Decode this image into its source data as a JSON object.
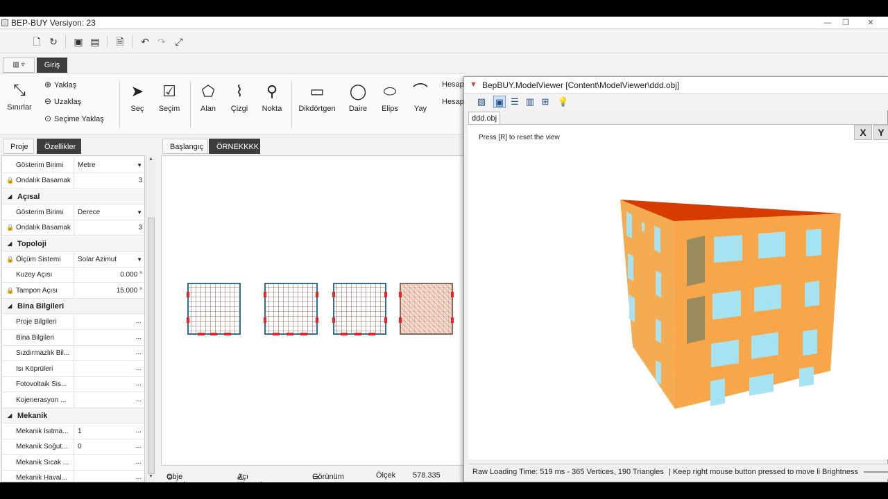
{
  "app": {
    "title": "BEP-BUY Versiyon: 23"
  },
  "ribbon": {
    "tab_giris": "Giriş",
    "sinirlar": "Sınırlar",
    "yaklas": "Yaklaş",
    "uzaklas": "Uzaklaş",
    "secime_yaklas": "Seçime Yaklaş",
    "sec": "Seç",
    "secim": "Seçim",
    "alan": "Alan",
    "cizgi": "Çizgi",
    "nokta": "Nokta",
    "dikdortgen": "Dikdörtgen",
    "daire": "Daire",
    "elips": "Elips",
    "yay": "Yay",
    "hesap1": "Hesap",
    "hesap2": "Hesap"
  },
  "left_tabs": {
    "proje": "Proje",
    "ozellikler": "Özellikler"
  },
  "properties": {
    "r1_label": "Gösterim Birimi",
    "r1_value": "Metre",
    "r2_label": "Ondalık Basamak",
    "r2_value": "3",
    "cat_acisal": "Açısal",
    "r3_label": "Gösterim Birimi",
    "r3_value": "Derece",
    "r4_label": "Ondalık Basamak",
    "r4_value": "3",
    "cat_topoloji": "Topoloji",
    "r5_label": "Ölçüm Sistemi",
    "r5_value": "Solar Azimut",
    "r6_label": "Kuzey Açısı",
    "r6_value": "0.000 °",
    "r7_label": "Tampon Açısı",
    "r7_value": "15.000 °",
    "cat_bina": "Bina Bilgileri",
    "r8_label": "Proje Bilgileri",
    "r9_label": "Bina Bilgileri",
    "r10_label": "Sızdırmazlık Bil...",
    "r11_label": "Isı Köprüleri",
    "r12_label": "Fotovoltaik Sis...",
    "r13_label": "Kojenerasyon ...",
    "cat_mekanik": "Mekanik",
    "r14_label": "Mekanik Isıtma...",
    "r14_value": "1",
    "r15_label": "Mekanik Soğut...",
    "r15_value": "0",
    "r16_label": "Mekanik Sıcak ...",
    "r17_label": "Mekanik Haval...",
    "dots": "..."
  },
  "doc_tabs": {
    "baslangic": "Başlangıç",
    "ornek": "ÖRNEKKKK"
  },
  "statusbar": {
    "obje_yakala": "Obje Yakala",
    "aci_klavuzlari": "Açı Klavuzları",
    "gorunum": "Görünüm",
    "olcek": "Ölçek",
    "olcek_value": "578.335"
  },
  "viewer": {
    "title": "BepBUY.ModelViewer  [Content\\ModelViewer\\ddd.obj]",
    "tab": "ddd.obj",
    "hint": "Press [R] to reset the view",
    "close": "X",
    "y": "Y",
    "status_loading": "Raw Loading Time: 519 ms - 365 Vertices, 190 Triangles",
    "status_help": "| Keep right mouse button pressed to move li",
    "status_brightness": "Brightness"
  },
  "colors": {
    "roof": "#d63b00",
    "wall": "#f7a64a",
    "wall_side": "#f4ab52",
    "window": "#a5e3f3",
    "door": "#9a8c5c"
  }
}
